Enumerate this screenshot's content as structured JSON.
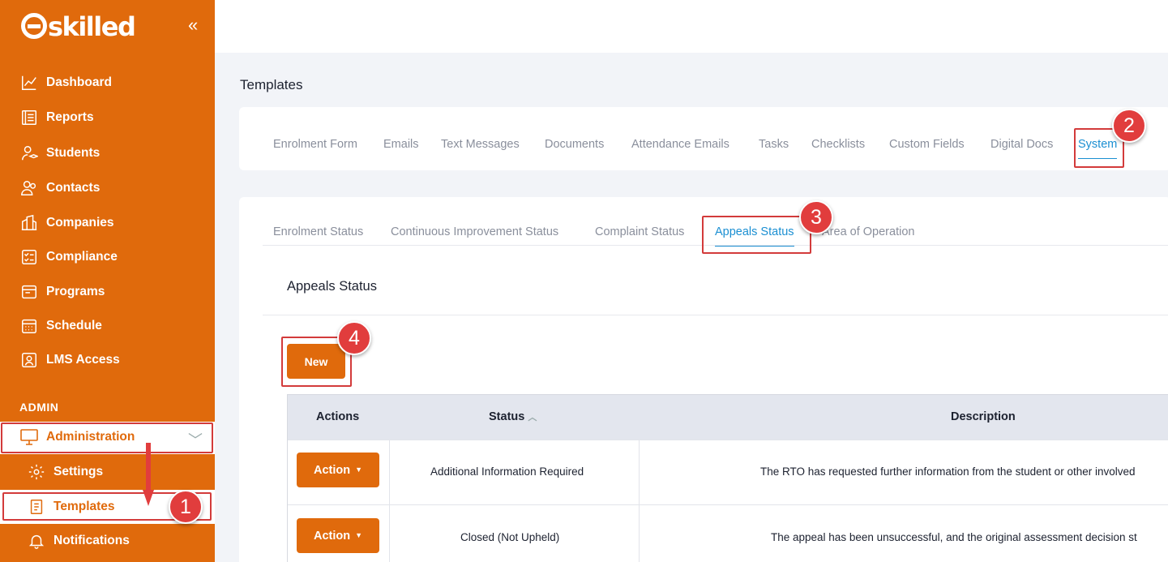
{
  "brand": {
    "logo_text": "skilled",
    "accent": "#e06a0c"
  },
  "sidebar": {
    "items": [
      {
        "label": "Dashboard",
        "icon": "chart-line-icon"
      },
      {
        "label": "Reports",
        "icon": "report-icon"
      },
      {
        "label": "Students",
        "icon": "students-icon"
      },
      {
        "label": "Contacts",
        "icon": "contacts-icon"
      },
      {
        "label": "Companies",
        "icon": "building-icon"
      },
      {
        "label": "Compliance",
        "icon": "checklist-icon"
      },
      {
        "label": "Programs",
        "icon": "programs-icon"
      },
      {
        "label": "Schedule",
        "icon": "calendar-icon"
      },
      {
        "label": "LMS Access",
        "icon": "lms-icon"
      }
    ],
    "admin_heading": "ADMIN",
    "administration_label": "Administration",
    "sub_items": {
      "settings": "Settings",
      "templates": "Templates",
      "notifications": "Notifications"
    }
  },
  "page": {
    "title": "Templates"
  },
  "template_tabs": [
    "Enrolment Form",
    "Emails",
    "Text Messages",
    "Documents",
    "Attendance Emails",
    "Tasks",
    "Checklists",
    "Custom Fields",
    "Digital Docs",
    "System"
  ],
  "system_tabs": [
    "Enrolment Status",
    "Continuous Improvement Status",
    "Complaint Status",
    "Appeals Status",
    "Area of Operation"
  ],
  "section": {
    "title": "Appeals Status",
    "new_button": "New"
  },
  "table": {
    "headers": [
      "Actions",
      "Status",
      "Description"
    ],
    "action_label": "Action",
    "rows": [
      {
        "status": "Additional Information Required",
        "description": "The RTO has requested further information from the student or other involved"
      },
      {
        "status": "Closed (Not Upheld)",
        "description": "The appeal has been unsuccessful, and the original assessment decision st"
      }
    ]
  },
  "annotations": [
    "1",
    "2",
    "3",
    "4"
  ]
}
